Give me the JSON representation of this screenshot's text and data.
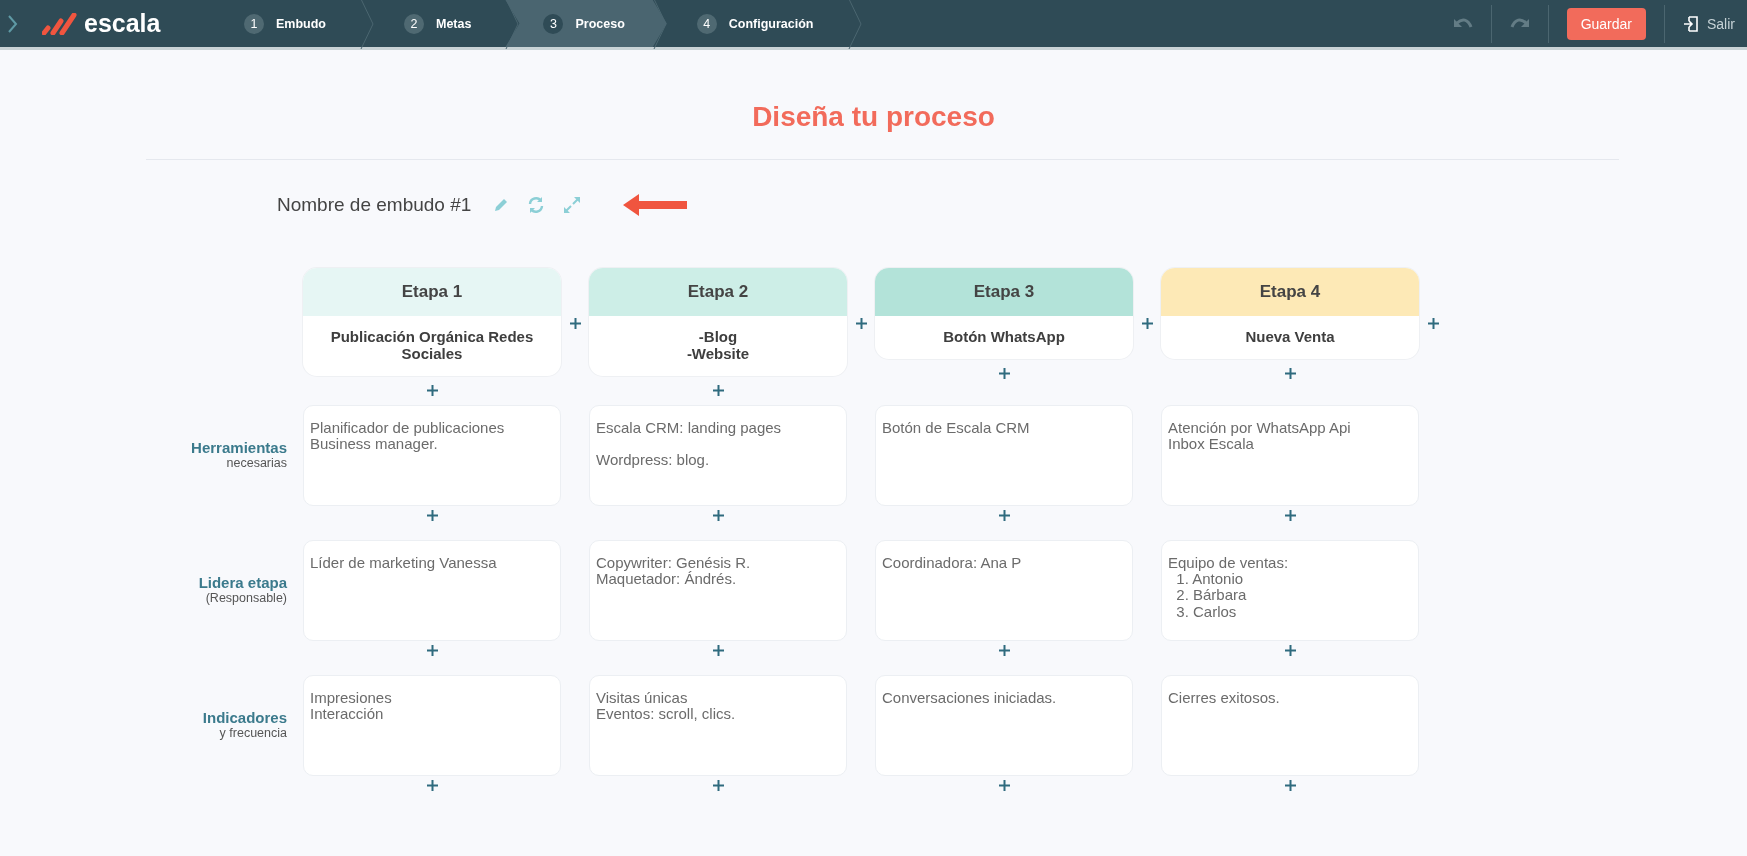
{
  "nav": {
    "steps": [
      {
        "number": "1",
        "label": "Embudo",
        "selected": false
      },
      {
        "number": "2",
        "label": "Metas",
        "selected": false
      },
      {
        "number": "3",
        "label": "Proceso",
        "selected": true
      },
      {
        "number": "4",
        "label": "Configuración",
        "selected": false
      }
    ],
    "logo": "escala",
    "save": "Guardar",
    "exit": "Salir"
  },
  "title": "Diseña tu proceso",
  "funnel": {
    "name": "Nombre de embudo #1"
  },
  "stages": [
    {
      "title": "Etapa 1",
      "color": "#e6f6f4",
      "name": "Publicación Orgánica Redes Sociales"
    },
    {
      "title": "Etapa 2",
      "color": "#cdeee7",
      "name": "-Blog\n-Website"
    },
    {
      "title": "Etapa 3",
      "color": "#b3e3d9",
      "name": "Botón WhatsApp"
    },
    {
      "title": "Etapa 4",
      "color": "#fde9b6",
      "name": "Nueva Venta"
    }
  ],
  "rows": [
    {
      "label": "Herramientas",
      "sublabel": "necesarias",
      "cells": [
        "Planificador de publicaciones\nBusiness manager.",
        "Escala CRM: landing pages\n\nWordpress: blog.",
        "Botón de Escala CRM",
        "Atención por WhatsApp Api\nInbox Escala"
      ]
    },
    {
      "label": "Lidera etapa",
      "sublabel": "(Responsable)",
      "cells": [
        "Líder de marketing Vanessa",
        "Copywriter: Genésis R.\nMaquetador: Ándrés.",
        "Coordinadora: Ana P",
        "Equipo de ventas:\n  1. Antonio\n  2. Bárbara\n  3. Carlos"
      ]
    },
    {
      "label": "Indicadores",
      "sublabel": "y frecuencia",
      "cells": [
        "Impresiones\nInteracción",
        "Visitas únicas\nEventos: scroll, clics.",
        "Conversaciones iniciadas.",
        "Cierres exitosos."
      ]
    }
  ]
}
